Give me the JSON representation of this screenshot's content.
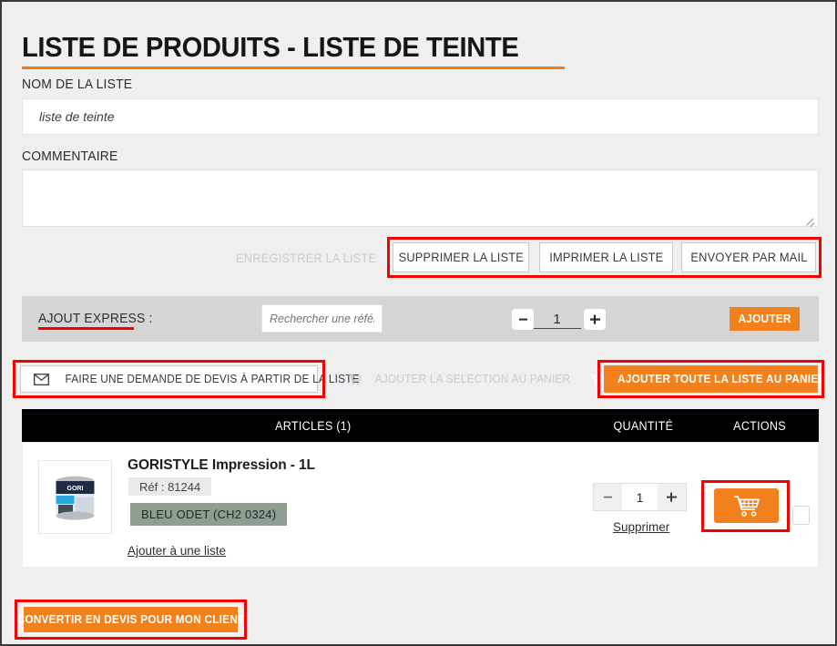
{
  "page": {
    "title": "LISTE DE PRODUITS - LISTE DE TEINTE",
    "accent_orange": "#f2801d",
    "annotation_red": "#f40000",
    "background": "#efefed"
  },
  "form": {
    "name_label": "NOM DE LA LISTE",
    "name_value": "liste de teinte",
    "comment_label": "COMMENTAIRE",
    "comment_value": ""
  },
  "list_actions": {
    "save": {
      "label": "ENREGISTRER LA LISTE",
      "disabled": true
    },
    "delete": {
      "label": "SUPPRIMER LA LISTE",
      "disabled": false
    },
    "print": {
      "label": "IMPRIMER LA LISTE",
      "disabled": false
    },
    "mail": {
      "label": "ENVOYER PAR MAIL",
      "disabled": false
    }
  },
  "express": {
    "label": "AJOUT EXPRESS :",
    "search_placeholder": "Rechercher une référenc",
    "search_value": "",
    "quantity": "1",
    "minus_icon": "minus-icon",
    "plus_icon": "plus-icon",
    "add_label": "AJOUTER"
  },
  "bulk_actions": {
    "quote": {
      "label": "FAIRE UNE DEMANDE DE DEVIS À PARTIR DE LA LISTE",
      "icon": "envelope-icon",
      "disabled": false
    },
    "add_selection": {
      "label": "AJOUTER LA SELECTION AU PANIER",
      "icon": "cart-icon",
      "disabled": true
    },
    "add_all": {
      "label": "AJOUTER TOUTE LA LISTE AU PANIER",
      "icon": "cart-icon",
      "disabled": false
    }
  },
  "table": {
    "headers": {
      "articles": "ARTICLES (1)",
      "quantity": "QUANTITÉ",
      "actions": "ACTIONS"
    },
    "rows": [
      {
        "name": "GORISTYLE Impression - 1L",
        "reference": "Réf : 81244",
        "color": "BLEU ODET (CH2 0324)",
        "color_swatch": "#8e9f91",
        "add_to_list_link": "Ajouter à une liste",
        "quantity": "1",
        "minus_icon": "minus-icon",
        "plus_icon": "plus-icon",
        "delete_link": "Supprimer",
        "cart_icon": "cart-icon",
        "thumbnail": "paint-can-gori"
      }
    ]
  },
  "footer": {
    "convert_label": "CONVERTIR EN DEVIS POUR MON CLIENT"
  }
}
